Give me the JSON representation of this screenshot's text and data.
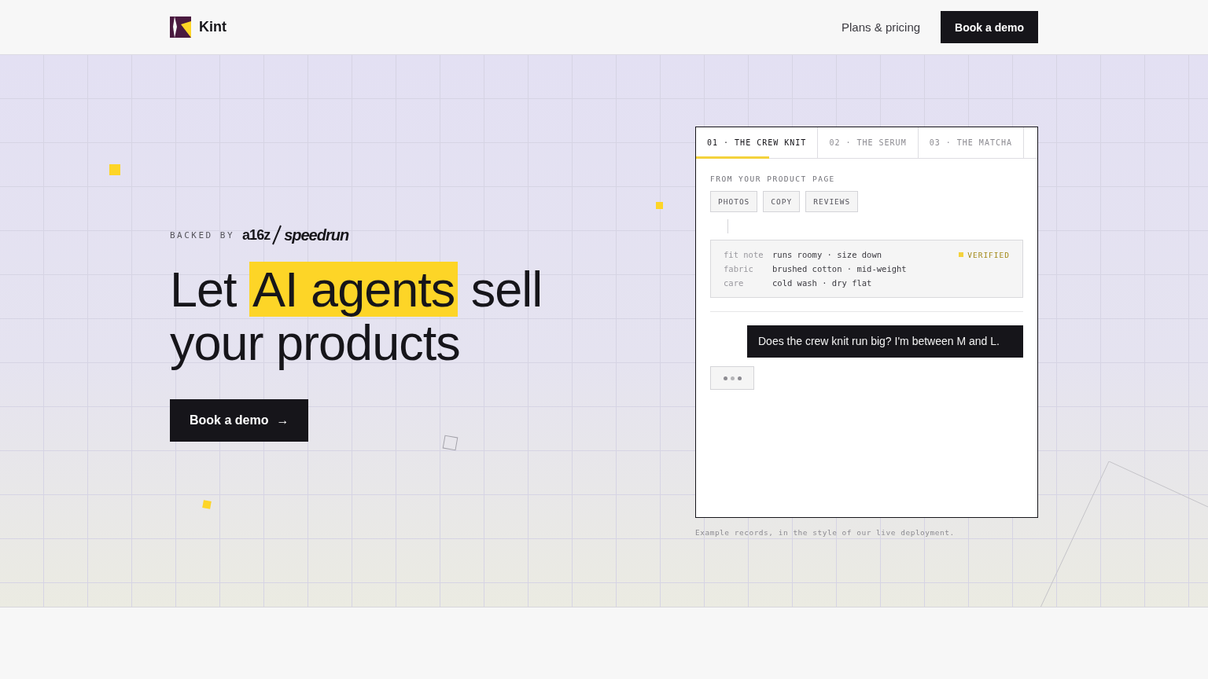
{
  "header": {
    "brand": "Kint",
    "nav_link": "Plans & pricing",
    "cta": "Book a demo"
  },
  "hero": {
    "backed_by": "BACKED BY",
    "backer_logo": {
      "left": "a16z",
      "right": "speedrun"
    },
    "headline": {
      "before": "Let ",
      "highlight": "AI agents",
      "after": " sell your products"
    },
    "cta": {
      "label": "Book a demo",
      "arrow": "→"
    }
  },
  "demo": {
    "tabs": [
      {
        "label": "01 · THE CREW KNIT",
        "selected": true
      },
      {
        "label": "02 · THE SERUM",
        "selected": false
      },
      {
        "label": "03 · THE MATCHA",
        "selected": false
      }
    ],
    "source_label": "FROM YOUR PRODUCT PAGE",
    "sources": [
      "PHOTOS",
      "COPY",
      "REVIEWS"
    ],
    "facts": [
      {
        "label": "fit note",
        "value": "runs roomy · size down",
        "badge": "VERIFIED"
      },
      {
        "label": "fabric",
        "value": "brushed cotton · mid-weight"
      },
      {
        "label": "care",
        "value": "cold wash · dry flat"
      }
    ],
    "messages": [
      {
        "kind": "user",
        "text": "Does the crew knit run big? I'm between M and L."
      },
      {
        "kind": "typing"
      }
    ]
  },
  "caption": "Example records, in the style of our live deployment."
}
